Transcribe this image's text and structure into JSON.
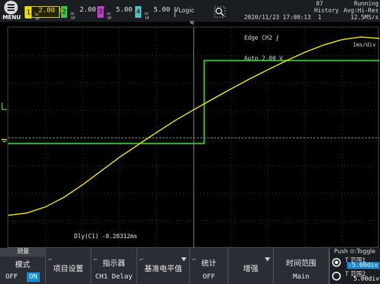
{
  "menu": {
    "label": "MENU"
  },
  "channels": [
    {
      "num": "1",
      "scale": "2.00 V",
      "coupling": [
        "DC",
        "1M"
      ]
    },
    {
      "num": "2",
      "scale": "2.00 V",
      "coupling": [
        "DC",
        "1M"
      ]
    },
    {
      "num": "3",
      "scale": "5.00 V",
      "coupling": [
        "DC",
        "1M"
      ]
    },
    {
      "num": "4",
      "scale": "5.00 V",
      "coupling": [
        "DC",
        "1M"
      ]
    }
  ],
  "logic_label": "Logic",
  "datetime": "2020/11/23 17:00:13",
  "trigger_info": [
    "Edge CH2 ⨏",
    "Auto 2.00 V"
  ],
  "history": {
    "count": "87",
    "label": "History",
    "index": "1"
  },
  "acq": {
    "state": "Running",
    "mode": "Avg:Hi-Res",
    "rate": "12.5MS/s"
  },
  "timebase": "1ms/div",
  "measurement_readout": "Dly(C1) -0.28312ms",
  "softkeys": {
    "measure": {
      "header": "测量",
      "title": "模式",
      "off": "OFF",
      "on": "ON"
    },
    "item_setup": {
      "title": "项目设置"
    },
    "indicator": {
      "title": "指示器",
      "value": "CH1 Delay"
    },
    "ref_level": {
      "title": "基准电平值"
    },
    "stats": {
      "title": "统计",
      "value": "OFF"
    },
    "enhance": {
      "title": "增强"
    },
    "time_range": {
      "title": "时间范围",
      "value": "Main"
    }
  },
  "knob_panel": {
    "title": "Push ⊙:Toggle",
    "row1": {
      "label": "T 范围1",
      "value": "-5.00div"
    },
    "row2": {
      "label": "T 范围2",
      "value": "5.00div"
    }
  },
  "colors": {
    "ch1": "#e8e000",
    "ch2": "#38c838",
    "ch3": "#c040c0",
    "ch4": "#40c8c8",
    "accent": "#1588d8"
  },
  "waveforms": {
    "ch1_description_units": "div",
    "ch1_points": [
      [
        -5.0,
        -2.8
      ],
      [
        -4.5,
        -2.72
      ],
      [
        -4.0,
        -2.5
      ],
      [
        -3.5,
        -2.15
      ],
      [
        -3.0,
        -1.7
      ],
      [
        -2.5,
        -1.2
      ],
      [
        -2.0,
        -0.7
      ],
      [
        -1.5,
        -0.25
      ],
      [
        -1.0,
        0.2
      ],
      [
        -0.5,
        0.63
      ],
      [
        0.0,
        1.02
      ],
      [
        0.5,
        1.4
      ],
      [
        1.0,
        1.77
      ],
      [
        1.5,
        2.13
      ],
      [
        2.0,
        2.47
      ],
      [
        2.5,
        2.8
      ],
      [
        3.0,
        3.1
      ],
      [
        3.5,
        3.36
      ],
      [
        4.0,
        3.56
      ],
      [
        4.5,
        3.65
      ],
      [
        5.0,
        3.6
      ]
    ],
    "ch2_low": -0.2,
    "ch2_high": 2.8,
    "ch2_edge_time": 0.28
  }
}
